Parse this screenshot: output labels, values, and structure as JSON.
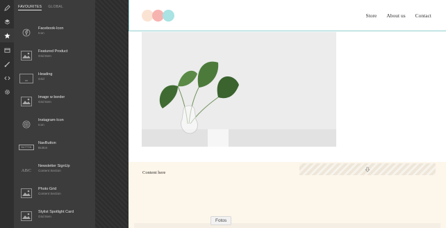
{
  "colors": {
    "rail_bg": "#2f2f2f",
    "panel_bg": "#3c3c3c",
    "header_border": "#8fcfcf",
    "lower_bg": "#fdf6ea",
    "logo": [
      "#fbe3d3",
      "#f7b3b0",
      "#a9e3e3"
    ]
  },
  "rail": {
    "icons": [
      "pencil-icon",
      "layers-icon",
      "star-icon",
      "library-icon",
      "brush-icon",
      "code-icon",
      "gear-icon"
    ],
    "active_index": 2
  },
  "panel": {
    "tabs": [
      "FAVOURITES",
      "GLOBAL"
    ],
    "active_tab": 0,
    "elements": [
      {
        "name": "Facebook-Icon",
        "type": "Icon",
        "thumb": "facebook-icon"
      },
      {
        "name": "Featured Product",
        "type": "Grid Item",
        "thumb": "image-icon"
      },
      {
        "name": "Heading",
        "type": "Grid",
        "thumb": "heading-icon"
      },
      {
        "name": "Image w border",
        "type": "Grid Item",
        "thumb": "image-icon"
      },
      {
        "name": "Instagram-Icon",
        "type": "Icon",
        "thumb": "instagram-icon"
      },
      {
        "name": "NavButton",
        "type": "Button",
        "thumb": "button-icon",
        "thumb_text": "BUTTON"
      },
      {
        "name": "Newsletter SignUp",
        "type": "Content Section",
        "thumb": "text-icon",
        "thumb_text": "ABC"
      },
      {
        "name": "Photo Grid",
        "type": "Content Section",
        "thumb": "image-icon"
      },
      {
        "name": "Stylist Spotlight Card",
        "type": "Grid Item",
        "thumb": "image-icon"
      }
    ]
  },
  "page": {
    "nav": [
      "Store",
      "About us",
      "Contact"
    ],
    "content_text": "Content here",
    "section_label": "Fotos"
  }
}
